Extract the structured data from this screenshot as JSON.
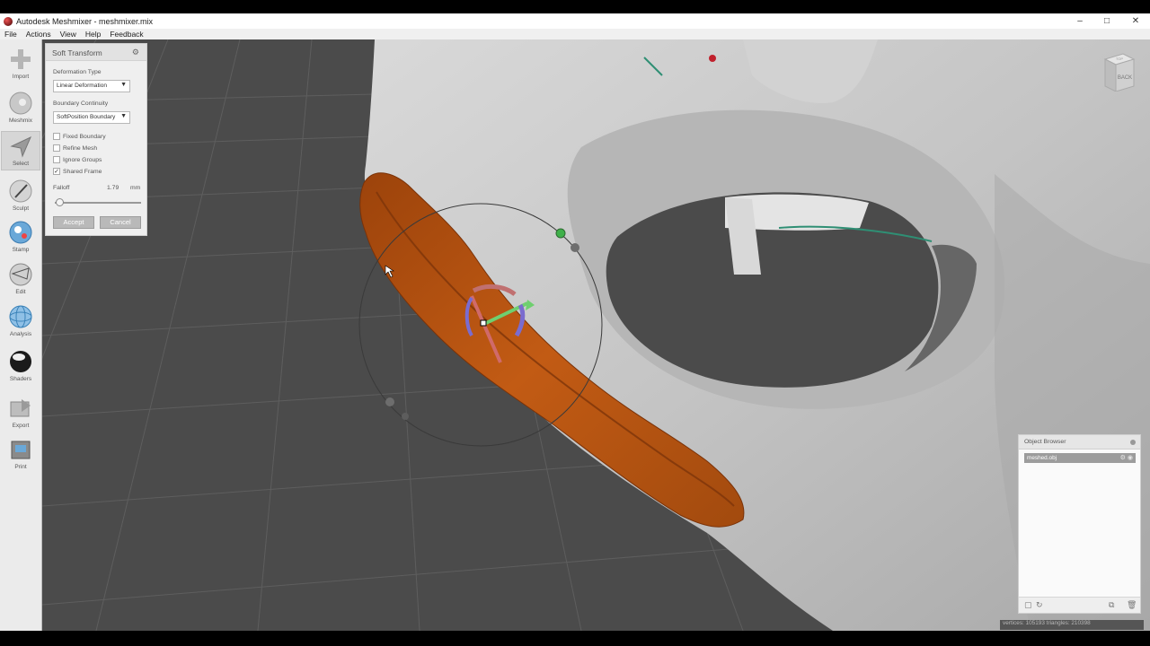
{
  "window": {
    "title": "Autodesk Meshmixer - meshmixer.mix",
    "controls": {
      "minimize": "–",
      "maximize": "□",
      "close": "✕"
    }
  },
  "menu": [
    "File",
    "Actions",
    "View",
    "Help",
    "Feedback"
  ],
  "toolbar": {
    "items": [
      {
        "label": "Import",
        "icon": "plus-icon"
      },
      {
        "label": "Meshmix",
        "icon": "meshmix-sphere-icon"
      },
      {
        "label": "Select",
        "icon": "select-arrow-icon",
        "active": true
      },
      {
        "label": "Sculpt",
        "icon": "brush-icon"
      },
      {
        "label": "Stamp",
        "icon": "stamp-icon"
      },
      {
        "label": "Edit",
        "icon": "edit-sphere-icon"
      },
      {
        "label": "Analysis",
        "icon": "analysis-sphere-icon"
      },
      {
        "label": "Shaders",
        "icon": "shader-sphere-icon"
      },
      {
        "label": "Export",
        "icon": "export-icon"
      },
      {
        "label": "Print",
        "icon": "printer-icon"
      }
    ]
  },
  "panel": {
    "title": "Soft Transform",
    "deformation_label": "Deformation Type",
    "deformation_value": "Linear Deformation",
    "boundary_label": "Boundary Continuity",
    "boundary_value": "SoftPosition Boundary",
    "checkboxes": [
      {
        "label": "Fixed Boundary",
        "checked": false
      },
      {
        "label": "Refine Mesh",
        "checked": false
      },
      {
        "label": "Ignore Groups",
        "checked": false
      },
      {
        "label": "Shared Frame",
        "checked": true
      }
    ],
    "falloff_label": "Falloff",
    "falloff_value": "1.79",
    "falloff_unit": "mm",
    "accept_label": "Accept",
    "cancel_label": "Cancel"
  },
  "viewcube": {
    "top": "TOP",
    "face": "BACK"
  },
  "object_browser": {
    "title": "Object Browser",
    "objects": [
      "meshed.obj"
    ]
  },
  "status": "vertices: 105193  triangles: 210398",
  "colors": {
    "viewport_bg": "#4b4b4b",
    "selection": "#b5520e",
    "mesh": "#c9c9c9"
  }
}
